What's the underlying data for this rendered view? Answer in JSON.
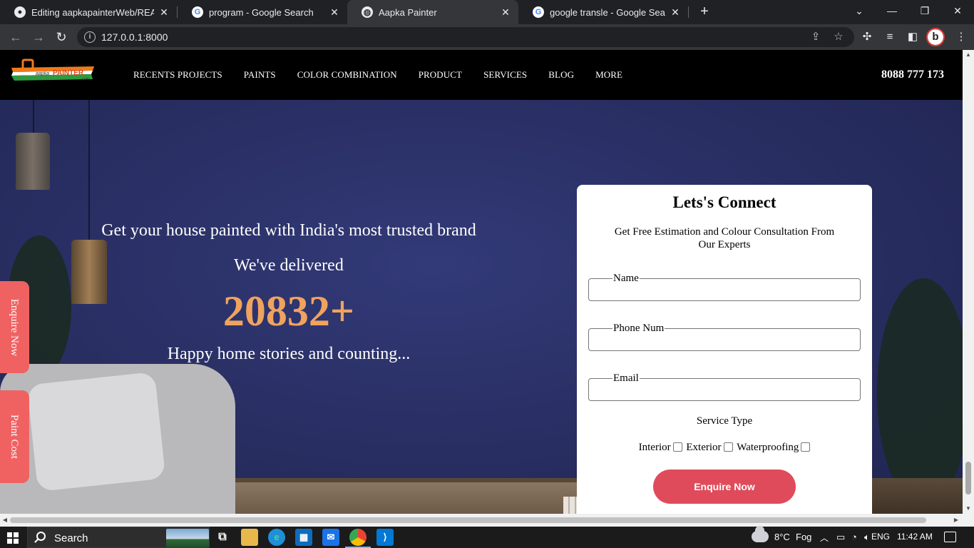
{
  "browser": {
    "tabs": [
      {
        "title": "Editing aapkapainterWeb/READM",
        "favicon": "github-icon",
        "active": false
      },
      {
        "title": "program - Google Search",
        "favicon": "google-icon",
        "active": false
      },
      {
        "title": "Aapka Painter",
        "favicon": "globe-icon",
        "active": true
      },
      {
        "title": "google transle - Google Search",
        "favicon": "google-icon",
        "active": false
      }
    ],
    "url": "127.0.0.1:8000"
  },
  "site": {
    "logo_text": "aapka PAINTER .com",
    "nav": [
      "RECENTS PROJECTS",
      "PAINTS",
      "COLOR COMBINATION",
      "PRODUCT",
      "SERVICES",
      "BLOG",
      "MORE"
    ],
    "phone": "8088 777 173"
  },
  "hero": {
    "tagline": "Get your house painted with India's most trusted brand",
    "delivered": "We've delivered",
    "count": "20832+",
    "footer": "Happy home stories and counting..."
  },
  "sidetabs": {
    "enquire": "Enquire Now",
    "paint_cost": "Paint Cost"
  },
  "form": {
    "title": "Lets's Connect",
    "subtitle": "Get Free Estimation and Colour Consultation From Our Experts",
    "fields": {
      "name": "Name",
      "phone": "Phone Num",
      "email": "Email"
    },
    "service_title": "Service Type",
    "services": [
      "Interior",
      "Exterior",
      "Waterproofing"
    ],
    "submit": "Enquire Now"
  },
  "taskbar": {
    "search": "Search",
    "weather_temp": "8°C",
    "weather_cond": "Fog",
    "language": "ENG",
    "time": "11:42 AM"
  },
  "colors": {
    "accent_count": "#f0a35e",
    "submit_button": "#e04b5b",
    "side_tab": "#f06262",
    "hero_bg": "#2a3065"
  }
}
